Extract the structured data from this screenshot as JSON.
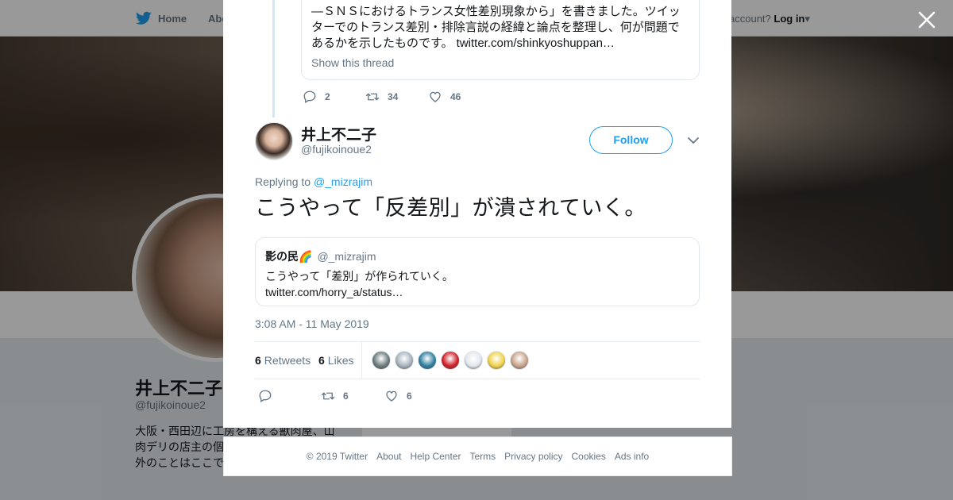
{
  "topnav": {
    "home_label": "Home",
    "about_label": "Abo",
    "account_prompt": "account?",
    "login_label": "Log in"
  },
  "profile": {
    "name": "井上不二子",
    "handle": "@fujikoinoue2",
    "bio": "大阪・西田辺に工房を構える獣肉屋、山 肉デリの店主の個 ョップアカウント 事以外のことはここでつぶやきます。",
    "card_text": "Ads info"
  },
  "thread_parent": {
    "quote_text": "—ＳＮＳにおけるトランス女性差別現象から」を書きました。ツイッターでのトランス差別・排除言説の経緯と論点を整理し、何が問題であるかを示したものです。 twitter.com/shinkyoshuppan…",
    "show_thread": "Show this thread",
    "replies": "2",
    "retweets": "34",
    "likes": "46"
  },
  "tweet": {
    "author_name": "井上不二子",
    "author_handle": "@fujikoinoue2",
    "follow_label": "Follow",
    "replying_prefix": "Replying to",
    "replying_handle": "@_mizrajim",
    "text": "こうやって「反差別」が潰されていく。",
    "quoted": {
      "name": "影の民🌈",
      "handle": "@_mizrajim",
      "text": "こうやって「差別」が作られていく。",
      "link": "twitter.com/horry_a/status…"
    },
    "timestamp": "3:08 AM - 11 May 2019",
    "retweet_count": "6",
    "retweet_label": "Retweets",
    "like_count": "6",
    "like_label": "Likes",
    "likers": [
      "#6b7b7b",
      "#a8b3bd",
      "#2f7fa0",
      "#d0202a",
      "#e2e8ee",
      "#f0d24b",
      "#c9a38a"
    ],
    "action_retweets": "6",
    "action_likes": "6"
  },
  "footer": {
    "copyright": "© 2019 Twitter",
    "links": [
      "About",
      "Help Center",
      "Terms",
      "Privacy policy",
      "Cookies",
      "Ads info"
    ]
  },
  "colors": {
    "accent": "#1da1f2",
    "secondary_text": "#657786",
    "thread_line": "#cfe7f7"
  }
}
